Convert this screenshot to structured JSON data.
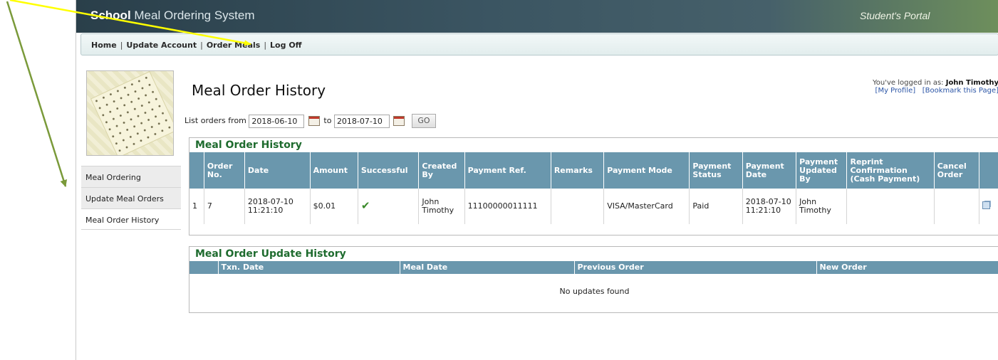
{
  "header": {
    "title_bold": "School",
    "title_rest": " Meal Ordering System",
    "portal": "Student's Portal"
  },
  "nav": {
    "items": [
      "Home",
      "Update Account",
      "Order Meals",
      "Log Off"
    ],
    "separator": "|"
  },
  "sidebar": {
    "items": [
      {
        "label": "Meal Ordering"
      },
      {
        "label": "Update Meal Orders"
      },
      {
        "label": "Meal Order History",
        "active": true
      }
    ]
  },
  "page": {
    "title": "Meal Order History"
  },
  "login": {
    "prefix": "You've logged in as: ",
    "user": "John Timothy",
    "my_profile": "[My Profile]",
    "bookmark": "[Bookmark this Page]"
  },
  "filter": {
    "label_from": "List orders from",
    "from": "2018-06-10",
    "label_to": "to",
    "to": "2018-07-10",
    "go": "GO"
  },
  "history": {
    "title": "Meal Order History",
    "columns": [
      "",
      "Order No.",
      "Date",
      "Amount",
      "Successful",
      "Created By",
      "Payment Ref.",
      "Remarks",
      "Payment Mode",
      "Payment Status",
      "Payment Date",
      "Payment Updated By",
      "Reprint Confirmation (Cash Payment)",
      "Cancel Order",
      ""
    ],
    "rows": [
      {
        "index": "1",
        "order_no": "7",
        "date": "2018-07-10 11:21:10",
        "amount": "$0.01",
        "successful": "✔",
        "created_by": "John Timothy",
        "payment_ref": "11100000011111",
        "remarks": "",
        "payment_mode": "VISA/MasterCard",
        "payment_status": "Paid",
        "payment_date": "2018-07-10 11:21:10",
        "payment_updated_by": "John Timothy",
        "reprint": "",
        "cancel": ""
      }
    ]
  },
  "updates": {
    "title": "Meal Order Update History",
    "columns": [
      "Txn. Date",
      "Meal Date",
      "Previous Order",
      "New Order"
    ],
    "empty": "No updates found"
  },
  "colors": {
    "header_bg": "#6a97ad",
    "panel_title": "#1e6b2e",
    "arrow_yellow": "#ffff00",
    "arrow_green": "#7a9a3a"
  }
}
